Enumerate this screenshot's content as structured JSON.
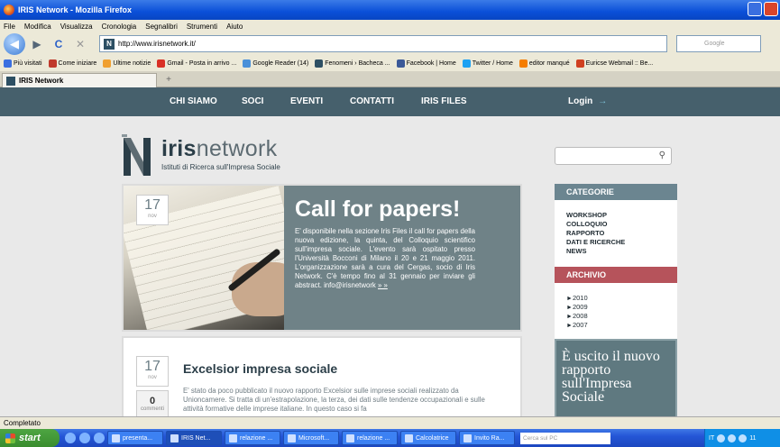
{
  "window": {
    "title": "IRIS Network - Mozilla Firefox"
  },
  "menu": [
    "File",
    "Modifica",
    "Visualizza",
    "Cronologia",
    "Segnalibri",
    "Strumenti",
    "Aiuto"
  ],
  "nav": {
    "url": "http://www.irisnetwork.it/",
    "search_placeholder": "Google"
  },
  "bookmarks": [
    {
      "label": "Più visitati",
      "color": "#3a6fe0"
    },
    {
      "label": "Come iniziare",
      "color": "#c0392b"
    },
    {
      "label": "Ultime notizie",
      "color": "#f0a030"
    },
    {
      "label": "Gmail - Posta in arrivo ...",
      "color": "#d93025"
    },
    {
      "label": "Google Reader (14)",
      "color": "#4a90d9"
    },
    {
      "label": "Fenomeni › Bacheca ...",
      "color": "#2d4f63"
    },
    {
      "label": "Facebook | Home",
      "color": "#3b5998"
    },
    {
      "label": "Twitter / Home",
      "color": "#1da1f2"
    },
    {
      "label": "editor manqué",
      "color": "#f57d00"
    },
    {
      "label": "Euricse Webmail :: Be...",
      "color": "#d04020"
    }
  ],
  "tab": {
    "title": "IRIS Network",
    "new_tab": "+"
  },
  "site": {
    "nav": [
      "CHI SIAMO",
      "SOCI",
      "EVENTI",
      "CONTATTI",
      "IRIS FILES"
    ],
    "login": "Login",
    "login_arrow": "→",
    "logo": {
      "bold": "iris",
      "light": "network",
      "tagline": "Istituti di Ricerca sull'Impresa Sociale"
    }
  },
  "feature": {
    "day": "17",
    "month": "nov",
    "title": "Call for papers!",
    "body": "E' disponibile nella sezione Iris Files il call for papers della nuova edizione, la quinta, del Colloquio scientifico sull'impresa sociale. L'evento sarà ospitato presso l'Università Bocconi di Milano il 20 e 21 maggio 2011. L'organizzazione sarà a cura del Cergas, socio di Iris Network. C'è tempo fino al 31 gennaio per inviare gli abstract. info@irisnetwork",
    "more": "» »"
  },
  "post": {
    "day": "17",
    "month": "nov",
    "comments_count": "0",
    "comments_label": "commenti",
    "title": "Excelsior impresa sociale",
    "body": "E' stato da poco pubblicato il nuovo rapporto Excelsior sulle imprese sociali realizzato da Unioncamere. Si tratta di un'estrapolazione, la terza, dei dati sulle tendenze occupazionali e sulle attività formative delle imprese italiane. In questo caso si fa"
  },
  "sidebar": {
    "categories_title": "CATEGORIE",
    "categories": [
      "WORKSHOP",
      "COLLOQUIO",
      "RAPPORTO",
      "DATI E RICERCHE",
      "NEWS"
    ],
    "archive_title": "ARCHIVIO",
    "archive": [
      "2010",
      "2009",
      "2008",
      "2007"
    ],
    "promo": "È uscito il nuovo rapporto sull'Impresa Sociale"
  },
  "status": "Completato",
  "taskbar": {
    "start": "start",
    "tasks": [
      "presenta...",
      "IRIS Net...",
      "relazione ...",
      "Microsoft...",
      "relazione ...",
      "Calcolatrice",
      "Invito Ra..."
    ],
    "search": "Cerca sul PC",
    "lang": "IT",
    "clock": "11"
  }
}
